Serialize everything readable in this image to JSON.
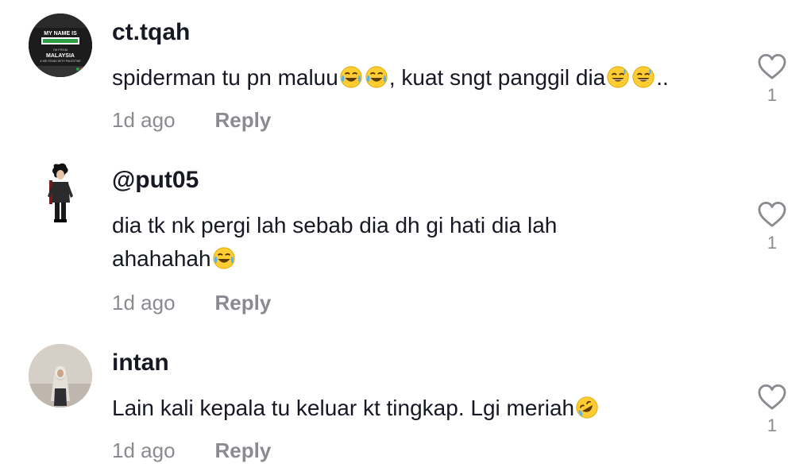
{
  "comments": [
    {
      "username": "ct.tqah",
      "text_segments": [
        "spiderman tu pn maluu",
        ", kuat sngt panggil dia",
        ".."
      ],
      "time": "1d ago",
      "reply_label": "Reply",
      "like_count": "1"
    },
    {
      "username": "@put05",
      "text_segments": [
        "dia tk nk pergi lah sebab dia dh gi hati dia lah ahahahah"
      ],
      "time": "1d ago",
      "reply_label": "Reply",
      "like_count": "1"
    },
    {
      "username": "intan",
      "text_segments": [
        "Lain kali kepala tu keluar kt tingkap. Lgi meriah"
      ],
      "time": "1d ago",
      "reply_label": "Reply",
      "like_count": "1"
    }
  ],
  "avatar_texts": {
    "first": [
      "MY NAME IS",
      "I'M FROM",
      "MALAYSIA",
      "& WE STAND WITH PALESTINE"
    ]
  },
  "icons": {
    "like": "heart-outline-icon",
    "tears_of_joy": "face-with-tears-of-joy-icon",
    "sweat_smile": "grinning-face-with-sweat-icon",
    "rofl": "rolling-on-the-floor-laughing-icon"
  },
  "colors": {
    "text": "#161823",
    "secondary": "#8a8b91",
    "background": "#ffffff"
  }
}
